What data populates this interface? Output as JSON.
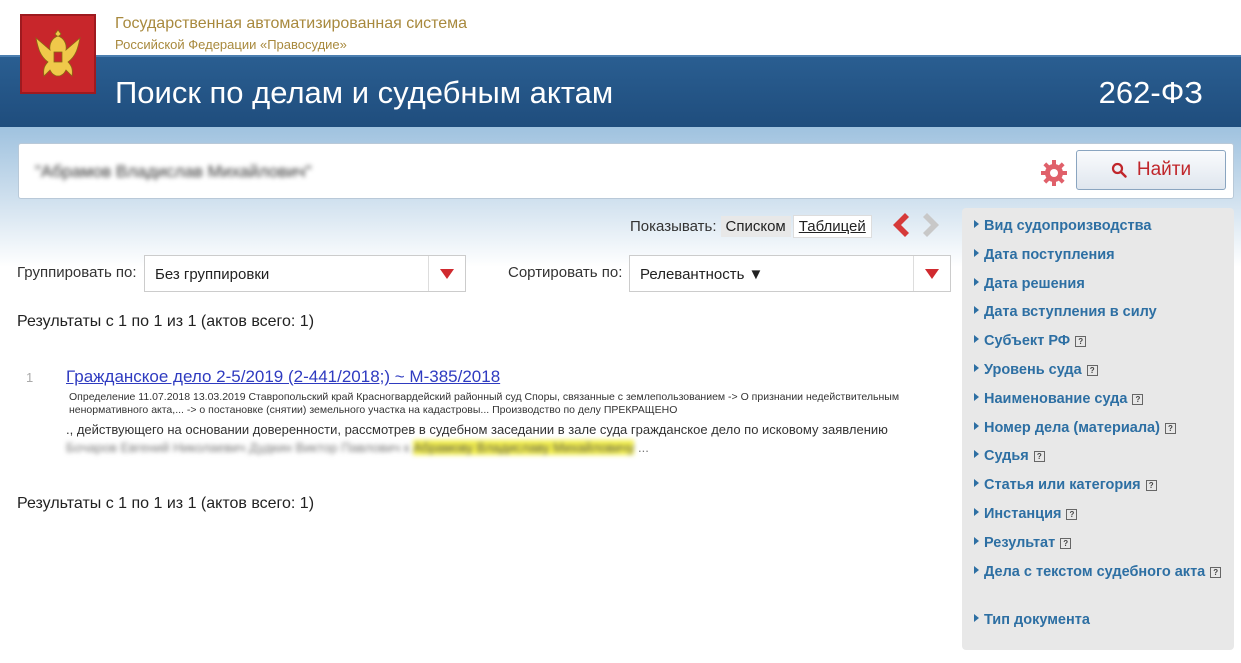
{
  "system": {
    "title": "Государственная автоматизированная система",
    "subtitle": "Российской Федерации «Правосудие»"
  },
  "banner": {
    "title": "Поиск по делам и судебным актам",
    "law": "262-ФЗ"
  },
  "search": {
    "query": "\"Абрамов Владислав Михайлович\"",
    "find_label": "Найти"
  },
  "view": {
    "label": "Показывать:",
    "list_label": "Списком",
    "table_label": "Таблицей"
  },
  "grouping": {
    "label": "Группировать по:",
    "value": "Без группировки"
  },
  "sorting": {
    "label": "Сортировать по:",
    "value": "Релевантность ▼"
  },
  "results": {
    "summary_top": "Результаты с 1 по 1 из 1 (актов всего: 1)",
    "summary_bottom": "Результаты с 1 по 1 из 1 (актов всего: 1)",
    "items": [
      {
        "num": "1",
        "title": "Гражданское дело 2-5/2019 (2-441/2018;) ~ М-385/2018",
        "meta": "Определение 11.07.2018 13.03.2019 Ставропольский край Красногвардейский районный суд Споры, связанные с землепользованием -> О признании недействительным ненормативного акта,... -> о постановке (снятии) земельного участка на кадастровы... Производство по делу ПРЕКРАЩЕНО",
        "snippet": "., действующего на основании доверенности, рассмотрев в судебном заседании в зале суда гражданское дело по исковому заявлению",
        "snippet_blur": "Бочаров Евгений Николаевич Дудкин Виктор Павлович к",
        "snippet_highlight": "Абрамову Владиславу Михайловичу",
        "snippet_tail": "..."
      }
    ]
  },
  "sidebar": {
    "items": [
      {
        "label": "Вид судопроизводства",
        "help": false
      },
      {
        "label": "Дата поступления",
        "help": false
      },
      {
        "label": "Дата решения",
        "help": false
      },
      {
        "label": "Дата вступления в силу",
        "help": false
      },
      {
        "label": "Субъект РФ",
        "help": true
      },
      {
        "label": "Уровень суда",
        "help": true
      },
      {
        "label": "Наименование суда",
        "help": true
      },
      {
        "label": "Номер дела (материала)",
        "help": true
      },
      {
        "label": "Судья",
        "help": true
      },
      {
        "label": "Статья или категория",
        "help": true
      },
      {
        "label": "Инстанция",
        "help": true
      },
      {
        "label": "Результат",
        "help": true
      },
      {
        "label": "Дела с текстом судебного акта",
        "help": true
      },
      {
        "label": "Тип документа",
        "help": false
      }
    ],
    "help_glyph": "?"
  },
  "colors": {
    "banner": "#1f4d7d",
    "accent_red": "#c0262b",
    "sidebar_link": "#2d6fa3",
    "result_link": "#2f3bc0",
    "highlight": "#f5f14c"
  },
  "icons": {
    "emblem": "coat-of-arms-icon",
    "gear": "gear-icon",
    "search": "search-icon",
    "prev": "chevron-left-icon",
    "next": "chevron-right-icon",
    "dropdown": "triangle-down-icon",
    "caret": "caret-right-icon",
    "help": "help-icon"
  }
}
